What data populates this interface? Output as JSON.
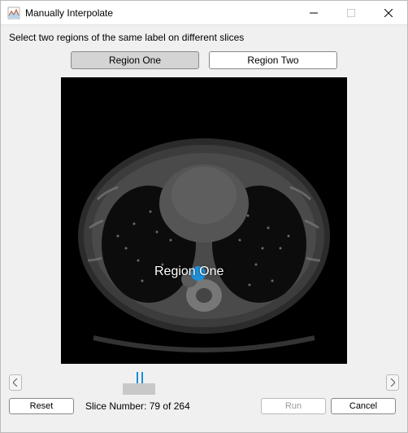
{
  "window": {
    "title": "Manually Interpolate"
  },
  "instruction": "Select two regions of the same label on different slices",
  "region_buttons": {
    "one": "Region One",
    "two": "Region Two"
  },
  "image": {
    "region_one_label": "Region One"
  },
  "slider": {
    "current": 79,
    "total": 264
  },
  "status": {
    "slice_text": "Slice Number: 79 of 264"
  },
  "buttons": {
    "reset": "Reset",
    "run": "Run",
    "cancel": "Cancel"
  }
}
